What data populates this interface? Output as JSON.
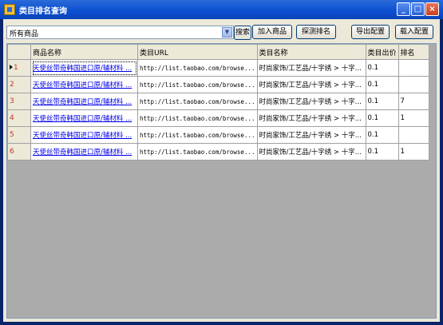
{
  "window": {
    "title": "类目排名查询"
  },
  "toolbar": {
    "category_select_value": "所有商品",
    "search_label": "搜索",
    "add_product_label": "加入商品",
    "detect_rank_label": "探测排名",
    "export_config_label": "导出配置",
    "load_config_label": "载入配置"
  },
  "grid": {
    "columns": [
      "商品名称",
      "类目URL",
      "类目名称",
      "类目出价",
      "排名"
    ],
    "rows": [
      {
        "num": "1",
        "name": "天使丝带奇韩国进口原/辅材料 ...",
        "url": "http://list.taobao.com/browse...",
        "category": "时尚家饰/工艺品/十字绣 > 十字...",
        "bid": "0.1",
        "rank": ""
      },
      {
        "num": "2",
        "name": "天使丝带奇韩国进口原/辅材料 ...",
        "url": "http://list.taobao.com/browse...",
        "category": "时尚家饰/工艺品/十字绣 > 十字...",
        "bid": "0.1",
        "rank": ""
      },
      {
        "num": "3",
        "name": "天使丝带奇韩国进口原/辅材料 ...",
        "url": "http://list.taobao.com/browse...",
        "category": "时尚家饰/工艺品/十字绣 > 十字...",
        "bid": "0.1",
        "rank": "7"
      },
      {
        "num": "4",
        "name": "天使丝带奇韩国进口原/辅材料 ...",
        "url": "http://list.taobao.com/browse...",
        "category": "时尚家饰/工艺品/十字绣 > 十字...",
        "bid": "0.1",
        "rank": "1"
      },
      {
        "num": "5",
        "name": "天使丝带奇韩国进口原/辅材料 ...",
        "url": "http://list.taobao.com/browse...",
        "category": "时尚家饰/工艺品/十字绣 > 十字...",
        "bid": "0.1",
        "rank": ""
      },
      {
        "num": "6",
        "name": "天使丝带奇韩国进口原/辅材料 ...",
        "url": "http://list.taobao.com/browse...",
        "category": "时尚家饰/工艺品/十字绣 > 十字...",
        "bid": "0.1",
        "rank": "1"
      }
    ]
  },
  "icons": {
    "app": "app-icon",
    "minimize": "minimize-icon",
    "maximize": "maximize-icon",
    "close": "close-icon",
    "dropdown": "chevron-down-icon",
    "current_row": "current-row-marker-icon"
  },
  "colors": {
    "title_bar": "#0b4fd0",
    "row_number": "#c0392b",
    "link": "#0000ee"
  }
}
